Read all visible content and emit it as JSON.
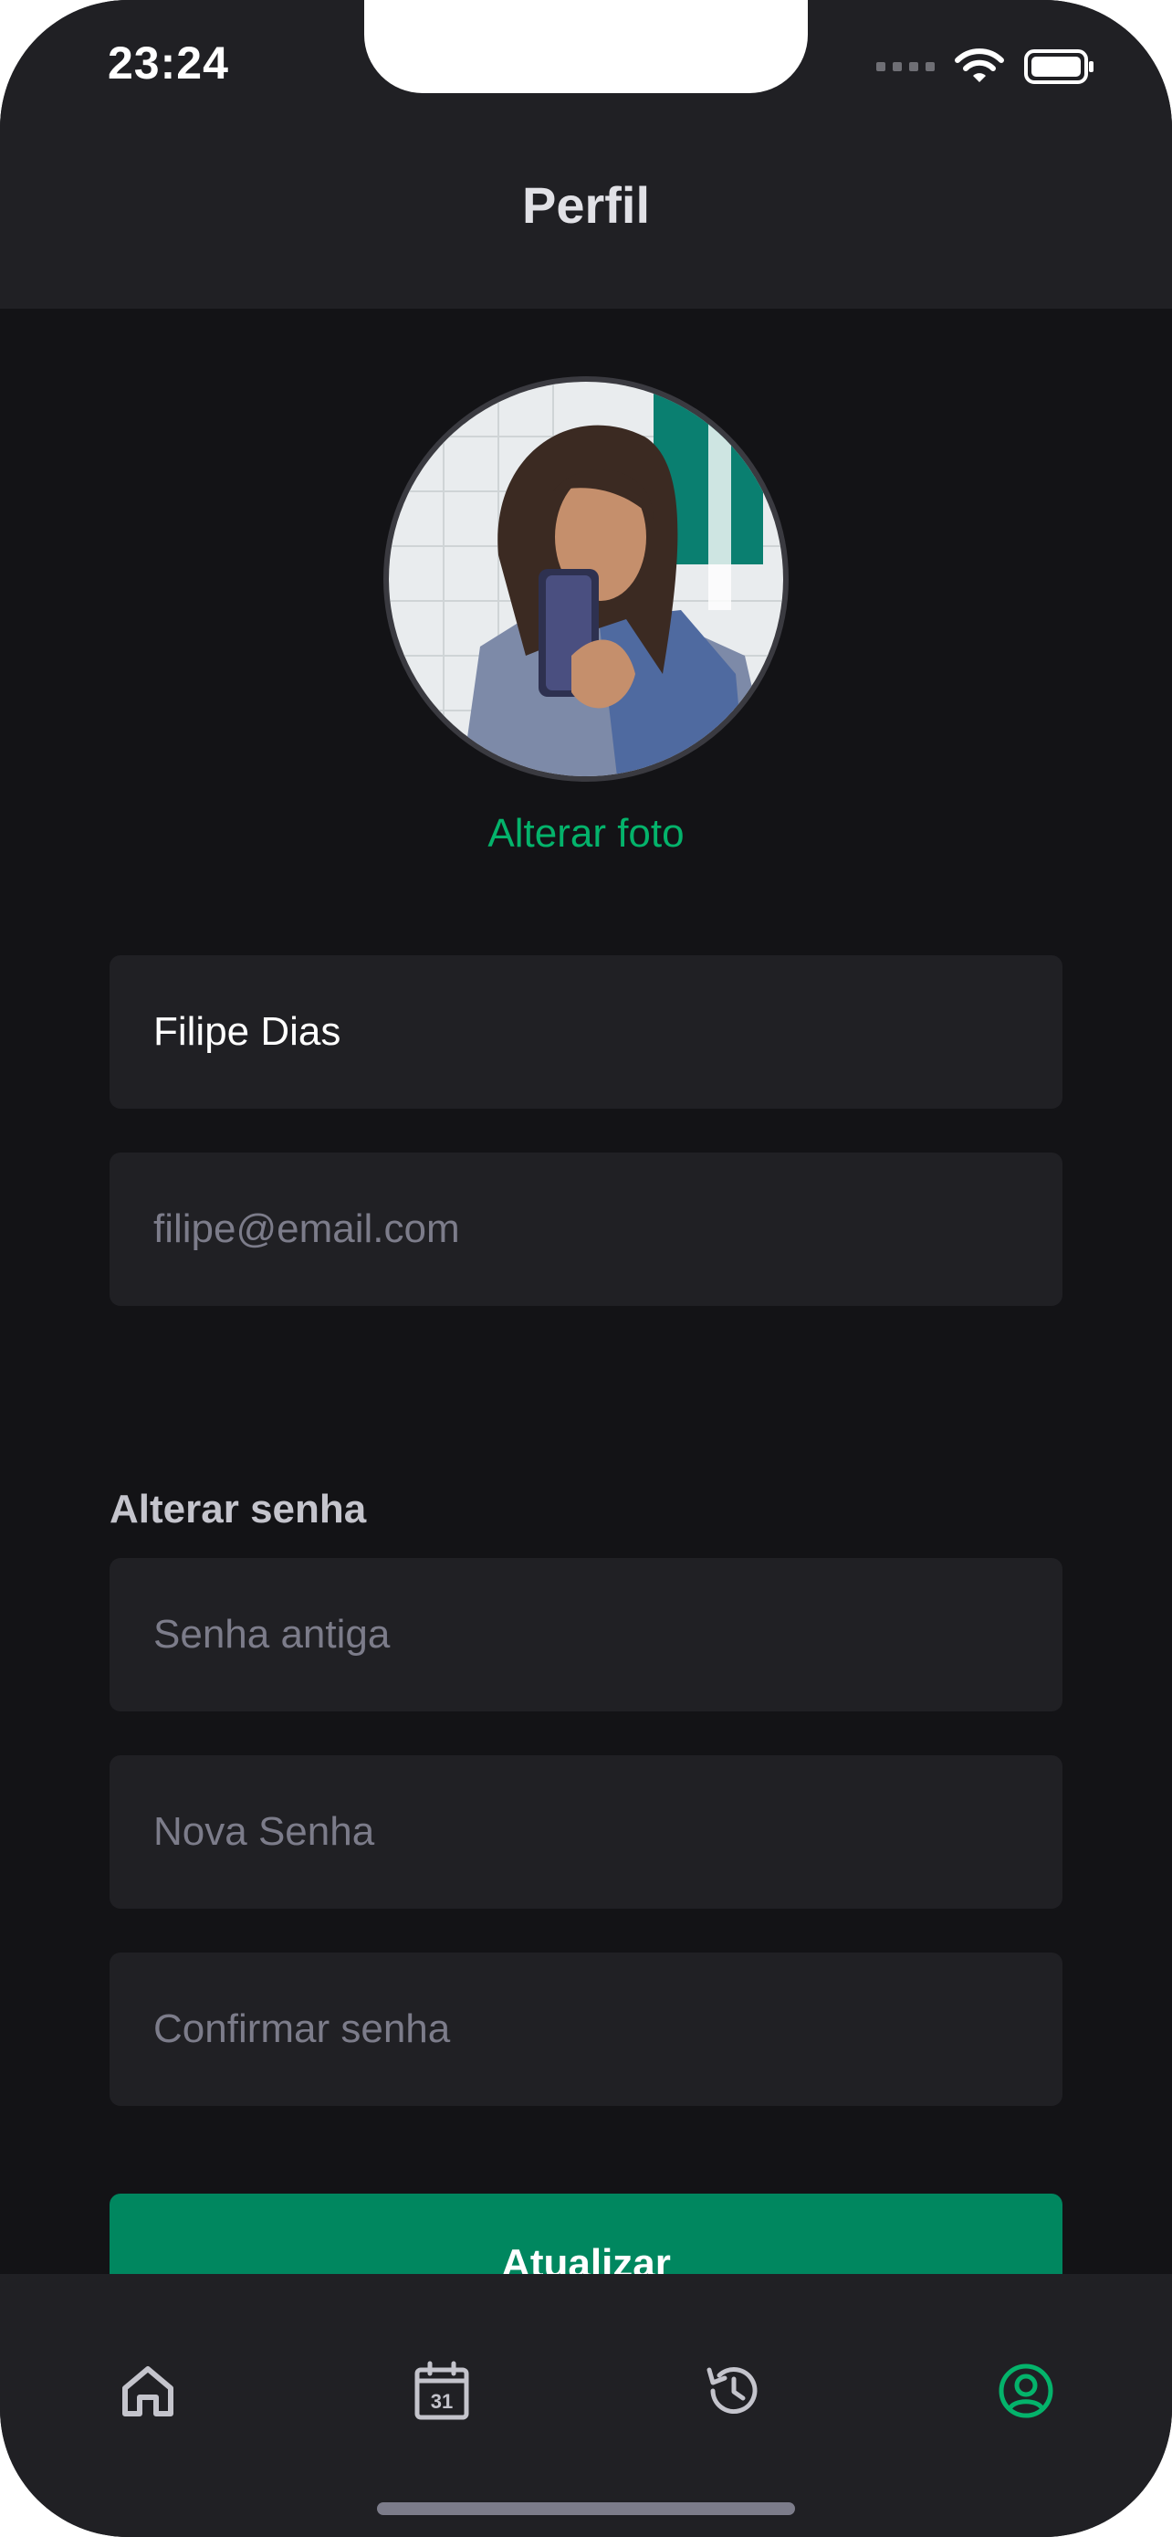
{
  "status_bar": {
    "time": "23:24"
  },
  "header": {
    "title": "Perfil"
  },
  "profile": {
    "change_photo_label": "Alterar foto"
  },
  "form": {
    "name_value": "Filipe Dias",
    "email_placeholder": "filipe@email.com",
    "password_section_title": "Alterar senha",
    "old_password_placeholder": "Senha antiga",
    "new_password_placeholder": "Nova Senha",
    "confirm_password_placeholder": "Confirmar senha",
    "submit_label": "Atualizar"
  },
  "tab_bar": {
    "calendar_day": "31",
    "active_tab": "profile",
    "icons": [
      "home-icon",
      "calendar-icon",
      "history-icon",
      "profile-icon"
    ]
  },
  "colors": {
    "background": "#131316",
    "surface": "#202024",
    "accent": "#04b36b",
    "button": "#00875f",
    "inactive_icon": "#c4c4cc"
  }
}
